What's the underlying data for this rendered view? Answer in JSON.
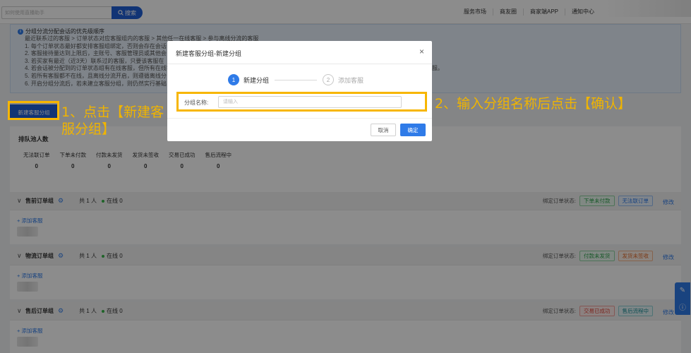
{
  "topbar": {
    "search_placeholder": "如何使用直播助手",
    "search_button": "搜索",
    "nav": [
      "服务市场",
      "商友圈",
      "商家端APP",
      "通知中心"
    ]
  },
  "notice": {
    "title": "分组分流分配会话的优先级顺序",
    "lines": [
      "最近联系过的客服 > 订单状态对应客服组内的客服 > 其他任一在线客服 > 参与离线分流的客服",
      "1. 每个订单状态最好都安排客服组绑定，否则会存在会话",
      "2. 客服接待量达到上限后，主账号、客服管理员或其他会",
      "3. 若买家有最近（近3天）联系过的客服，只要该客服在",
      "4. 若会话被分配到的订单状态组有在线客服，但所有在线客服都达到接待上限，会话会分配给其他组内的在线客服，若所有组客服都达到上限，将分配给其他在线客服。",
      "5. 若所有客服都不在线，且离线分流开启，则遵循离线分",
      "6. 开启分组分流后，若未建立客服分组，则仍然实行基础"
    ]
  },
  "create_button": "新建客服分组",
  "annotations": {
    "step1": "1、点击【新建客服分组】",
    "step2": "2、输入分组名称后点击【确认】"
  },
  "queue": {
    "title": "排队池人数",
    "columns": [
      {
        "label": "无法联订单",
        "value": "0"
      },
      {
        "label": "下单未付款",
        "value": "0"
      },
      {
        "label": "付款未发货",
        "value": "0"
      },
      {
        "label": "发货未签收",
        "value": "0"
      },
      {
        "label": "交易已成功",
        "value": "0"
      },
      {
        "label": "售后流程中",
        "value": "0"
      }
    ]
  },
  "groups": [
    {
      "name": "售前订单组",
      "count": "共 1 人",
      "online": "在线 0",
      "bind_label": "绑定订单状态:",
      "tags": [
        {
          "text": "下单未付款",
          "color": "green"
        },
        {
          "text": "无法联订单",
          "color": "blue"
        }
      ],
      "edit": "修改",
      "add": "+ 添加客服"
    },
    {
      "name": "物流订单组",
      "count": "共 1 人",
      "online": "在线 0",
      "bind_label": "绑定订单状态:",
      "tags": [
        {
          "text": "付款未发货",
          "color": "green"
        },
        {
          "text": "发货未签收",
          "color": "orange"
        }
      ],
      "edit": "修改",
      "add": "+ 添加客服"
    },
    {
      "name": "售后订单组",
      "count": "共 1 人",
      "online": "在线 0",
      "bind_label": "绑定订单状态:",
      "tags": [
        {
          "text": "交易已成功",
          "color": "red"
        },
        {
          "text": "售后流程中",
          "color": "teal"
        }
      ],
      "edit": "修改",
      "add": "+ 添加客服"
    }
  ],
  "modal": {
    "title": "新建客服分组-新建分组",
    "close": "×",
    "steps": [
      {
        "num": "1",
        "label": "新建分组"
      },
      {
        "num": "2",
        "label": "添加客服"
      }
    ],
    "field_label": "分组名称:",
    "field_placeholder": "请输入",
    "cancel": "取消",
    "ok": "确定"
  },
  "icons": {
    "search": "search-icon",
    "info": "info-icon",
    "gear": "gear-icon",
    "close": "close-icon",
    "chevron": "chevron-down-icon",
    "edit": "edit-icon"
  },
  "colors": {
    "primary": "#2f7be8",
    "brand": "#1f5fd6",
    "annotation": "#f0b400",
    "highlight_box": "#f7b600"
  }
}
